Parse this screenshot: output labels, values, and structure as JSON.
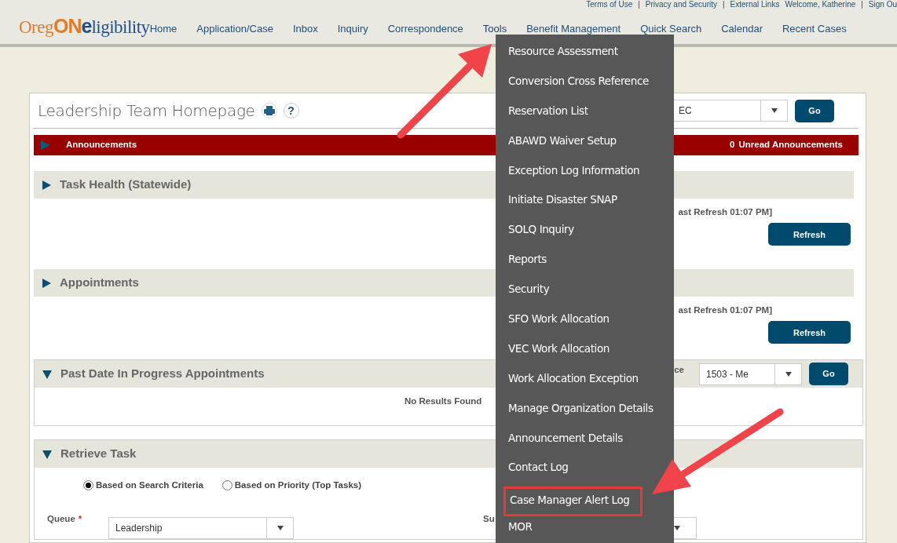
{
  "top_links": [
    "Terms of Use",
    "|",
    "Privacy and Security",
    "|",
    "External Links",
    "Welcome, Katherine",
    "|",
    "Sign Ou"
  ],
  "logo": {
    "parts": [
      {
        "text": "Oreg",
        "color": "#e27c2a",
        "bold": false
      },
      {
        "text": "ON",
        "color": "#e27c2a",
        "bold": true
      },
      {
        "text": "e",
        "color": "#1f4e8c",
        "bold": true
      },
      {
        "text": "ligibility",
        "color": "#1f4e8c",
        "bold": false
      }
    ]
  },
  "nav": [
    {
      "label": "Home",
      "open": false
    },
    {
      "label": "Application/Case",
      "open": false
    },
    {
      "label": "Inbox",
      "open": false
    },
    {
      "label": "Inquiry",
      "open": false
    },
    {
      "label": "Correspondence",
      "open": false
    },
    {
      "label": "Tools",
      "open": true
    },
    {
      "label": "Benefit Management",
      "open": false
    },
    {
      "label": "Quick Search",
      "open": false
    },
    {
      "label": "Calendar",
      "open": false
    },
    {
      "label": "Recent Cases",
      "open": false
    }
  ],
  "menu": {
    "items": [
      {
        "label": "Resource Assessment",
        "highlighted": false
      },
      {
        "label": "Conversion Cross Reference",
        "highlighted": false
      },
      {
        "label": "Reservation List",
        "highlighted": false
      },
      {
        "label": "ABAWD Waiver Setup",
        "highlighted": false
      },
      {
        "label": "Exception Log Information",
        "highlighted": false
      },
      {
        "label": "Initiate Disaster SNAP",
        "highlighted": false
      },
      {
        "label": "SOLQ Inquiry",
        "highlighted": false
      },
      {
        "label": "Reports",
        "highlighted": false
      },
      {
        "label": "Security",
        "highlighted": false
      },
      {
        "label": "SFO Work Allocation",
        "highlighted": false
      },
      {
        "label": "VEC Work Allocation",
        "highlighted": false
      },
      {
        "label": "Work Allocation Exception",
        "highlighted": false
      },
      {
        "label": "Manage Organization Details",
        "highlighted": false
      },
      {
        "label": "Announcement Details",
        "highlighted": false
      },
      {
        "label": "Contact Log",
        "highlighted": false
      },
      {
        "label": "Case Manager Alert Log",
        "highlighted": true
      },
      {
        "label": "MOR",
        "highlighted": false
      }
    ]
  },
  "page": {
    "title": "Leadership Team Homepage",
    "help": "?",
    "select_value": "EC",
    "go": "Go"
  },
  "announcements": {
    "label": "Announcements",
    "count": "0",
    "count_label": "Unread Announcements"
  },
  "sections": [
    {
      "kind": "refresh",
      "title": "Task Health (Statewide)",
      "expanded": false,
      "last_refresh": "ast Refresh 01:07 PM]",
      "button": "Refresh"
    },
    {
      "kind": "refresh",
      "title": "Appointments",
      "expanded": false,
      "last_refresh": "ast Refresh 01:07 PM]",
      "button": "Refresh"
    },
    {
      "kind": "office",
      "title": "Past Date In Progress Appointments",
      "expanded": true,
      "office_label": "ce",
      "office_value": "1503 - Me",
      "go": "Go",
      "message": "No Results Found"
    },
    {
      "kind": "task",
      "title": "Retrieve Task",
      "expanded": true,
      "radios": [
        {
          "label": "Based on Search Criteria",
          "selected": true
        },
        {
          "label": "Based on Priority (Top Tasks)",
          "selected": false
        }
      ],
      "queue_label": "Queue",
      "required": "*",
      "queue_value": "Leadership",
      "sub_label": "Su"
    }
  ]
}
